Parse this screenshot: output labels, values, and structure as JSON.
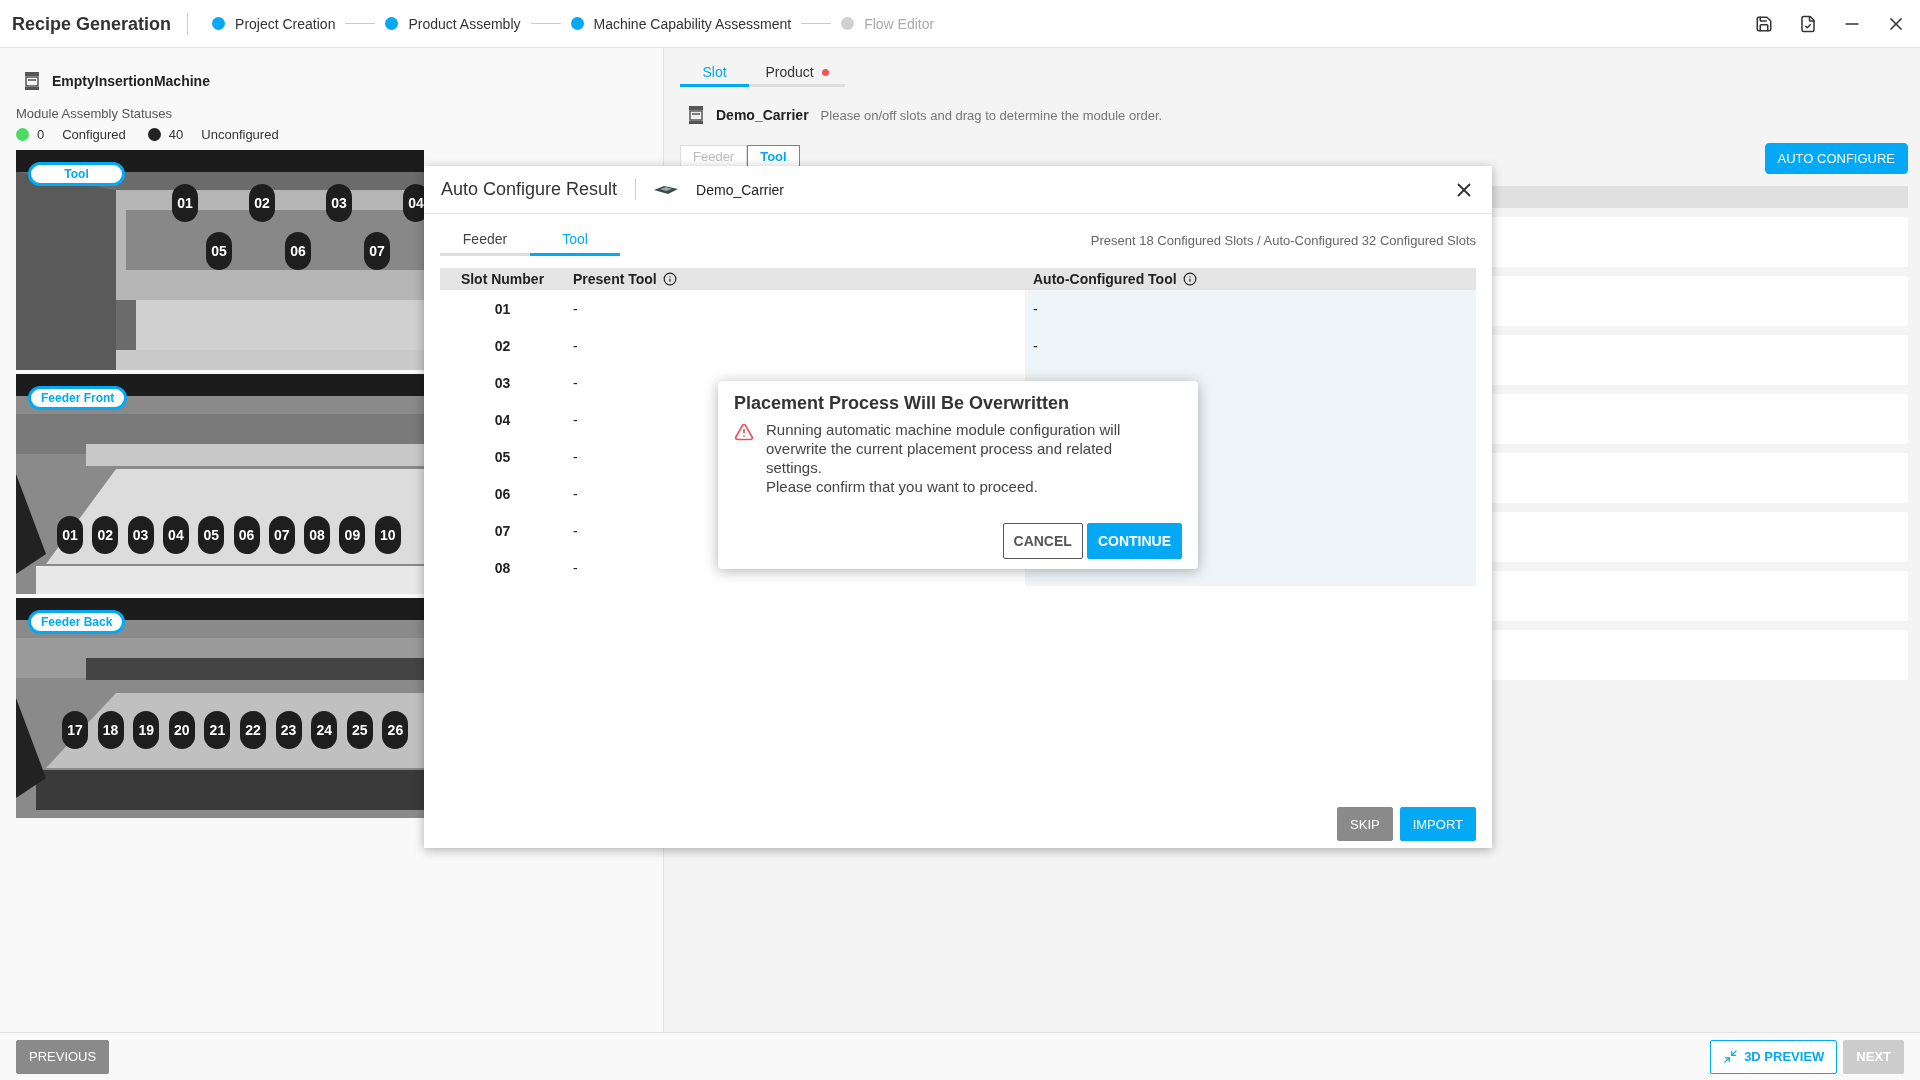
{
  "app": {
    "title": "Recipe Generation"
  },
  "steps": [
    {
      "label": "Project Creation",
      "done": true
    },
    {
      "label": "Product Assembly",
      "done": true
    },
    {
      "label": "Machine Capability Assessment",
      "done": true
    },
    {
      "label": "Flow Editor",
      "done": false
    }
  ],
  "machine": {
    "name": "EmptyInsertionMachine",
    "statuses_title": "Module Assembly Statuses",
    "statuses": [
      {
        "count": "0",
        "label": "Configured",
        "color": "#4cd964"
      },
      {
        "count": "40",
        "label": "Unconfigured",
        "color": "#222222"
      }
    ]
  },
  "views": [
    {
      "label": "Tool",
      "kind": "tool",
      "slots": [
        "01",
        "02",
        "03",
        "04",
        "05",
        "06",
        "07"
      ]
    },
    {
      "label": "Feeder Front",
      "kind": "front",
      "slots": [
        "01",
        "02",
        "03",
        "04",
        "05",
        "06",
        "07",
        "08",
        "09",
        "10"
      ]
    },
    {
      "label": "Feeder Back",
      "kind": "back",
      "slots": [
        "17",
        "18",
        "19",
        "20",
        "21",
        "22",
        "23",
        "24",
        "25",
        "26"
      ]
    }
  ],
  "slot_panel": {
    "tabs": [
      {
        "label": "Slot",
        "selected": true,
        "alert": false
      },
      {
        "label": "Product",
        "selected": false,
        "alert": true
      }
    ],
    "carrier": "Demo_Carrier",
    "hint": "Please on/off slots and drag to determine the module order.",
    "module_tabs": [
      {
        "label": "Feeder",
        "selected": false
      },
      {
        "label": "Tool",
        "selected": true
      }
    ],
    "auto_configure": "AUTO CONFIGURE"
  },
  "result_dialog": {
    "title": "Auto Configure Result",
    "carrier": "Demo_Carrier",
    "tabs": [
      {
        "label": "Feeder",
        "selected": false
      },
      {
        "label": "Tool",
        "selected": true
      }
    ],
    "summary": "Present 18 Configured Slots / Auto-Configured 32 Configured Slots",
    "columns": [
      {
        "label": "Slot Number",
        "info": false
      },
      {
        "label": "Present Tool",
        "info": true
      },
      {
        "label": "Auto-Configured Tool",
        "info": true
      }
    ],
    "rows": [
      {
        "slot": "01",
        "present": "-",
        "auto": "-"
      },
      {
        "slot": "02",
        "present": "-",
        "auto": "-"
      },
      {
        "slot": "03",
        "present": "-"
      },
      {
        "slot": "04",
        "present": "-"
      },
      {
        "slot": "05",
        "present": "-"
      },
      {
        "slot": "06",
        "present": "-"
      },
      {
        "slot": "07",
        "present": "-"
      },
      {
        "slot": "08",
        "present": "-"
      }
    ],
    "buttons": [
      {
        "label": "SKIP",
        "kind": "secondary"
      },
      {
        "label": "IMPORT",
        "kind": "primary"
      }
    ]
  },
  "confirm_dialog": {
    "title": "Placement Process Will Be Overwritten",
    "message": [
      "Running automatic machine module configuration will overwrite the current placement process and related settings.",
      "Please confirm that you want to proceed."
    ],
    "buttons": [
      {
        "label": "CANCEL",
        "kind": "outline"
      },
      {
        "label": "CONTINUE",
        "kind": "primary"
      }
    ]
  },
  "footer": {
    "previous": "PREVIOUS",
    "preview": "3D PREVIEW",
    "next": {
      "label": "NEXT",
      "disabled": true
    }
  }
}
